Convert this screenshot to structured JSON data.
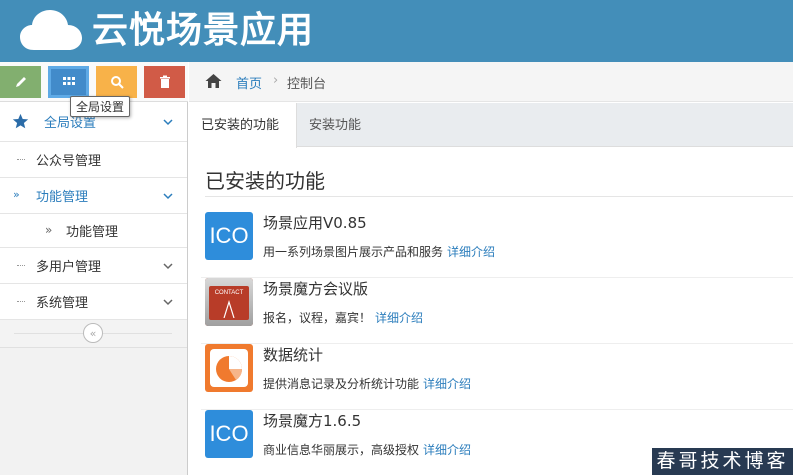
{
  "header": {
    "title": "云悦场景应用",
    "logo_icon": "cloud-icon"
  },
  "sidebar": {
    "shortcuts": [
      {
        "icon": "pencil-icon",
        "color": "#82af6f"
      },
      {
        "icon": "grid-icon",
        "color": "#428bca"
      },
      {
        "icon": "search-icon",
        "color": "#f8b249"
      },
      {
        "icon": "trash-icon",
        "color": "#d15b47"
      }
    ],
    "tooltip": "全局设置",
    "items": [
      {
        "label": "全局设置",
        "icon": "star-icon"
      },
      {
        "label": "公众号管理"
      },
      {
        "label": "功能管理"
      },
      {
        "label": "功能管理"
      },
      {
        "label": "多用户管理"
      },
      {
        "label": "系统管理"
      }
    ]
  },
  "breadcrumb": {
    "home": "首页",
    "current": "控制台"
  },
  "tabs": [
    {
      "label": "已安装的功能"
    },
    {
      "label": "安装功能"
    }
  ],
  "main": {
    "title": "已安装的功能",
    "apps": [
      {
        "name": "场景应用V0.85",
        "icon_text": "ICO",
        "desc": "用一系列场景图片展示产品和服务",
        "link": "详细介绍"
      },
      {
        "name": "场景魔方会议版",
        "icon_text": "CONTACT",
        "desc": "报名，议程，嘉宾！",
        "link": "详细介绍"
      },
      {
        "name": "数据统计",
        "icon": "pie-chart-icon",
        "desc": "提供消息记录及分析统计功能",
        "link": "详细介绍"
      },
      {
        "name": "场景魔方1.6.5",
        "icon_text": "ICO",
        "desc": "商业信息华丽展示，高级授权",
        "link": "详细介绍"
      }
    ]
  },
  "watermark": "春哥技术博客"
}
